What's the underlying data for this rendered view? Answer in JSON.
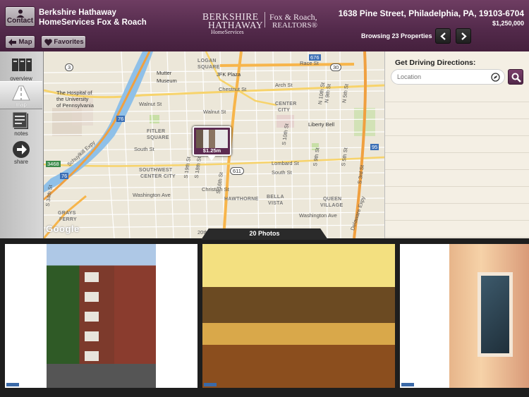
{
  "header": {
    "contact_label": "Contact",
    "agent_line1": "Berkshire Hathaway",
    "agent_line2": "HomeServices Fox & Roach",
    "logo": {
      "line1": "BERKSHIRE",
      "line2": "HATHAWAY",
      "line3": "HomeServices",
      "right1": "Fox & Roach,",
      "right2": "REALTORS®"
    },
    "address": "1638 Pine Street, Philadelphia, PA, 19103-6704",
    "price": "$1,250,000",
    "map_label": "Map",
    "favorites_label": "Favorites",
    "browsing": "Browsing 23 Properties"
  },
  "sidebar": {
    "items": [
      {
        "label": "overview",
        "icon": "overview-icon"
      },
      {
        "label": "map",
        "icon": "map-icon"
      },
      {
        "label": "notes",
        "icon": "notes-icon"
      },
      {
        "label": "share",
        "icon": "share-icon"
      }
    ]
  },
  "map": {
    "marker_price": "$1.25m",
    "attribution": "Google",
    "labels": {
      "logan": "LOGAN",
      "square": "SQUARE",
      "jfk": "JFK Plaza",
      "mutter1": "Mutter",
      "mutter2": "Museum",
      "hospital1": "The Hospital of",
      "hospital2": "the University",
      "hospital3": "of Pennsylvania",
      "walnut": "Walnut St",
      "walnut2": "Walnut St",
      "chestnut": "Chestnut St",
      "arch": "Arch St",
      "race": "Race St",
      "center1": "CENTER",
      "center2": "CITY",
      "liberty": "Liberty Bell",
      "fitler1": "FITLER",
      "fitler2": "SQUARE",
      "south": "South St",
      "south2": "South St",
      "lombard": "Lombard St",
      "sw1": "SOUTHWEST",
      "sw2": "CENTER CITY",
      "christian": "Christian St",
      "washington": "Washington Ave",
      "washington2": "Washington Ave",
      "hawthorne": "HAWTHORNE",
      "bella1": "BELLA",
      "bella2": "VISTA",
      "queen1": "QUEEN",
      "queen2": "VILLAGE",
      "grays1": "GRAYS",
      "grays2": "FERRY",
      "schuylkill": "Schuylkill Expy",
      "delaware": "Delaware Expy",
      "st19": "S 19th St",
      "st18": "S 18th St",
      "st16": "S 16th St",
      "st10": "S 10th St",
      "st9": "S 9th St",
      "st5": "S 5th St",
      "st3": "S 3rd St",
      "n10": "N 10th St",
      "n9": "N 9th St",
      "n5": "N 5th St",
      "st34": "S 34th St",
      "st20": "20th St",
      "h3": "3",
      "h30": "30",
      "h76a": "76",
      "h76b": "76",
      "h676": "676",
      "h95": "95",
      "h611": "611",
      "h3468": "3468"
    }
  },
  "directions": {
    "title": "Get Driving Directions:",
    "placeholder": "Location"
  },
  "photos": {
    "count_label": "20 Photos"
  }
}
